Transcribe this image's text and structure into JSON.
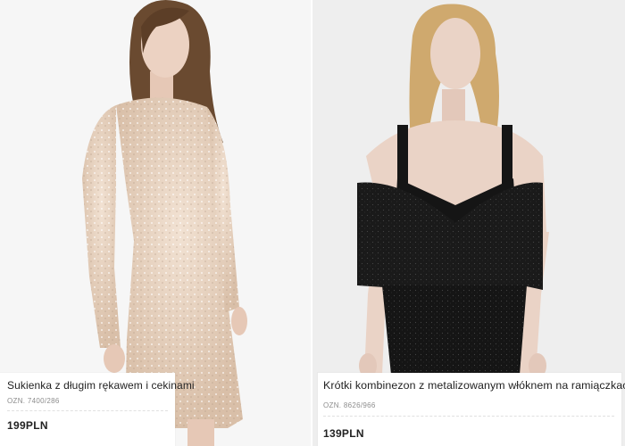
{
  "products": [
    {
      "name": "Sukienka z długim rękawem i cekinami",
      "ref": "OZN. 7400/286",
      "price": "199PLN",
      "image": "model-sequin-long-sleeve-dress",
      "colors": {
        "background": "#f6f6f6",
        "garment": "#e8d3c0",
        "hair": "#6a4a30",
        "skin": "#ecd2c2"
      }
    },
    {
      "name": "Krótki kombinezon z metalizowanym włóknem na ramiączkach",
      "ref": "OZN. 8626/966",
      "price": "139PLN",
      "image": "model-black-cold-shoulder-playsuit",
      "colors": {
        "background": "#eeeeee",
        "garment": "#151515",
        "hair": "#cfa96e",
        "skin": "#ead3c6"
      }
    }
  ]
}
